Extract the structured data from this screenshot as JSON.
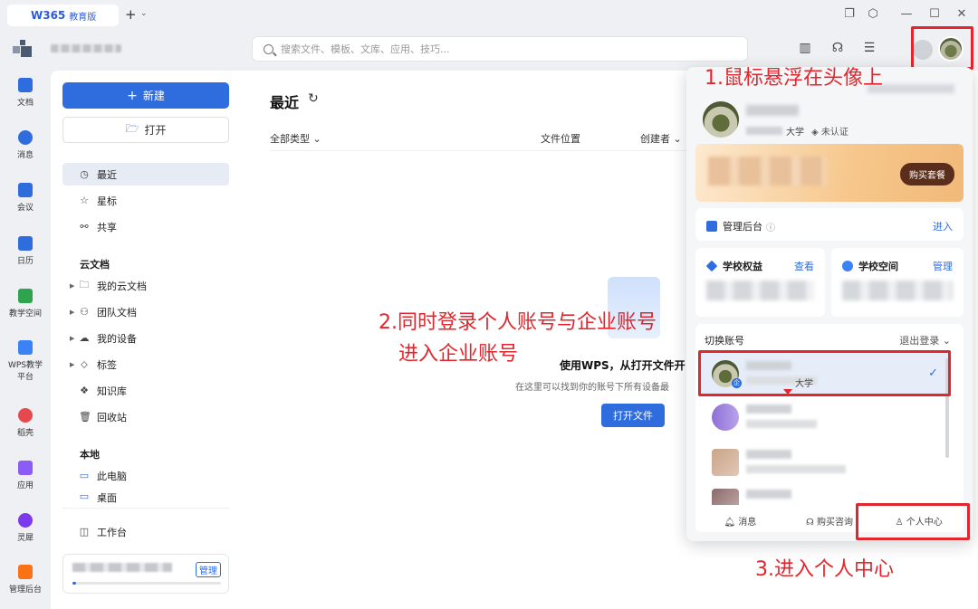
{
  "titlebar": {
    "logo": "W365",
    "edition": "教育版",
    "new_tab": "+",
    "new_tab_chevron": "⌄",
    "min": "—",
    "max": "☐",
    "close": "✕"
  },
  "search": {
    "placeholder": "搜索文件、模板、文库、应用、技巧..."
  },
  "rail": [
    {
      "label": "文档",
      "color": "#2f6ddf"
    },
    {
      "label": "消息",
      "color": "#2f6ddf"
    },
    {
      "label": "会议",
      "color": "#2f6ddf"
    },
    {
      "label": "日历",
      "color": "#2f6ddf"
    },
    {
      "label": "教学空间",
      "color": "#2ea44f"
    },
    {
      "label": "WPS教学",
      "label2": "平台",
      "color": "#3b82f6"
    },
    {
      "label": "稻壳",
      "color": "#e5484d"
    },
    {
      "label": "应用",
      "color": "#8b5cf6"
    },
    {
      "label": "灵犀",
      "color": "#7c3aed"
    },
    {
      "label": "管理后台",
      "color": "#f97316"
    }
  ],
  "sidebar": {
    "new_label": "新建",
    "open_label": "打开",
    "nav": {
      "recent": "最近",
      "star": "星标",
      "share": "共享"
    },
    "cloud_section": "云文档",
    "cloud": {
      "my": "我的云文档",
      "team": "团队文档",
      "device": "我的设备",
      "tag": "标签",
      "kb": "知识库",
      "trash": "回收站"
    },
    "local_section": "本地",
    "local": {
      "pc": "此电脑",
      "desktop": "桌面"
    },
    "workbench": "工作台",
    "storage_manage": "管理"
  },
  "main": {
    "title": "最近",
    "filter_type": "全部类型 ⌄",
    "col_location": "文件位置",
    "col_creator": "创建者 ⌄",
    "empty_title": "使用WPS，从打开文件开",
    "empty_sub": "在这里可以找到你的账号下所有设备最",
    "open_file": "打开文件"
  },
  "panel": {
    "org_suffix": "大学",
    "verify": "未认证",
    "buy": "购买套餐",
    "admin": "管理后台",
    "admin_info": "ⓘ",
    "enter": "进入",
    "rights": "学校权益",
    "view": "查看",
    "space": "学校空间",
    "manage": "管理",
    "switch": "切换账号",
    "logout": "退出登录 ⌄",
    "school": "大学",
    "qiye_badge": "企",
    "check": "✓",
    "footer": {
      "msg": "消息",
      "consult": "购买咨询",
      "center": "个人中心"
    }
  },
  "annotations": {
    "a1": "1.鼠标悬浮在头像上",
    "a2_line1": "2.同时登录个人账号与企业账号",
    "a2_line2": "进入企业账号",
    "a3": "3.进入个人中心"
  }
}
